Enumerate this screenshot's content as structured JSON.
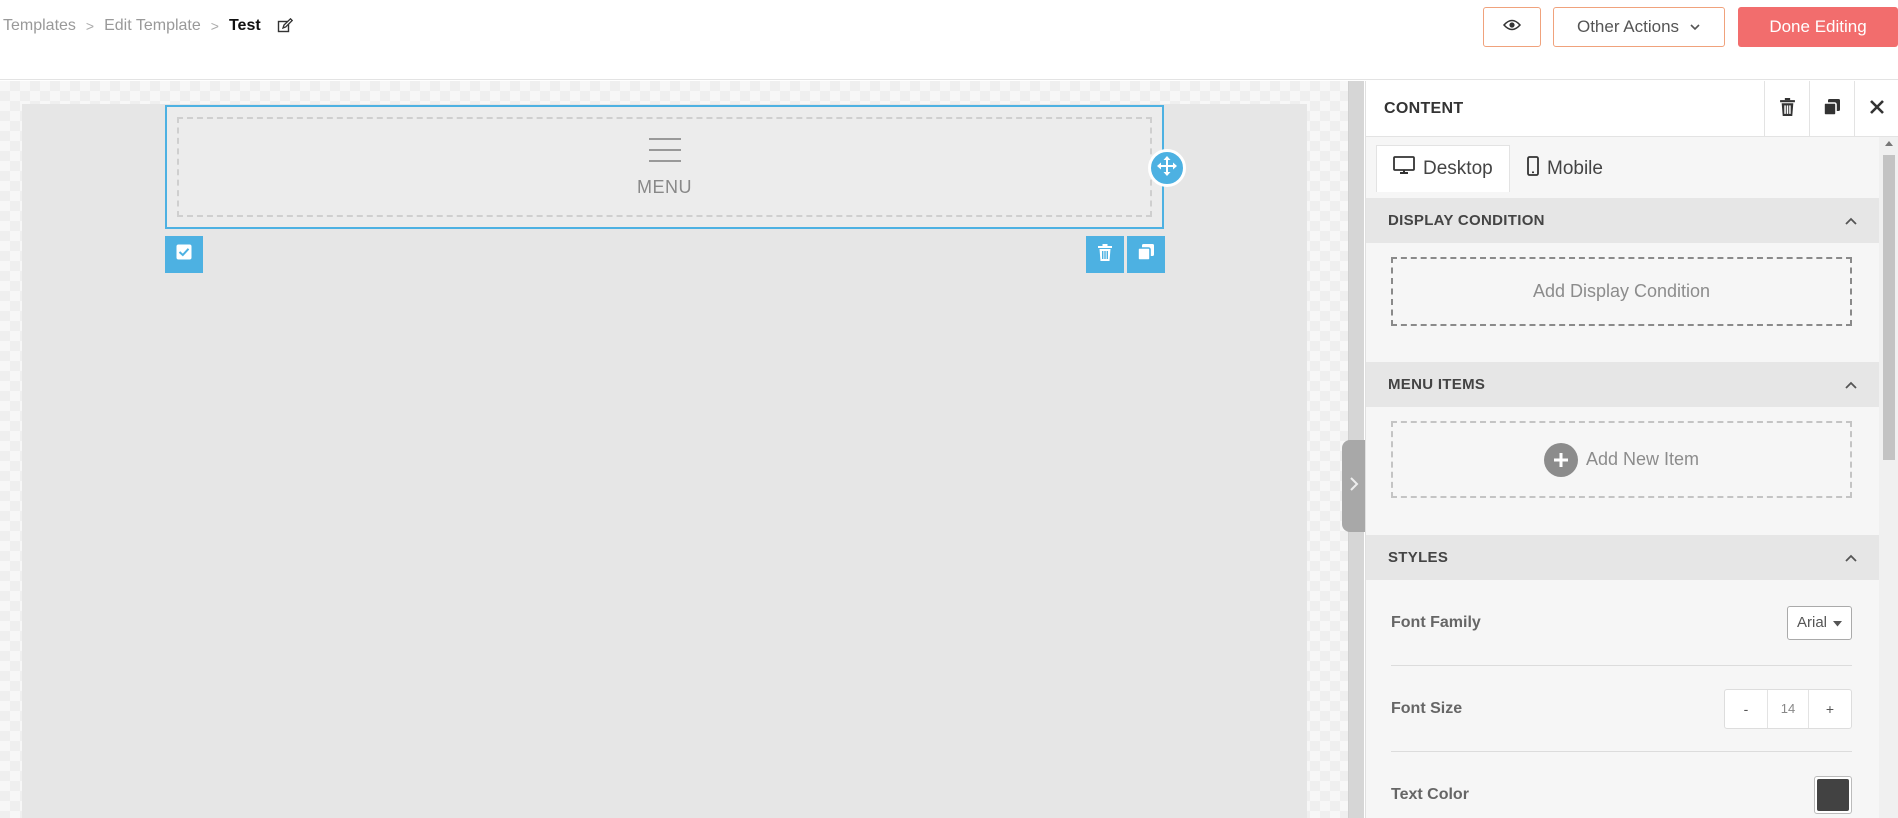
{
  "breadcrumb": {
    "items": [
      "Templates",
      "Edit Template"
    ],
    "separator": ">",
    "current": "Test"
  },
  "header": {
    "preview_icon": "eye-icon",
    "other_actions_label": "Other Actions",
    "done_label": "Done Editing"
  },
  "canvas": {
    "menu_label": "MENU"
  },
  "panel": {
    "title": "CONTENT",
    "tabs": [
      {
        "label": "Desktop",
        "icon": "desktop-icon",
        "active": true
      },
      {
        "label": "Mobile",
        "icon": "mobile-icon",
        "active": false
      }
    ],
    "sections": {
      "display_condition": {
        "title": "DISPLAY CONDITION",
        "button": "Add Display Condition"
      },
      "menu_items": {
        "title": "MENU ITEMS",
        "button": "Add New Item"
      },
      "styles": {
        "title": "STYLES",
        "font_family": {
          "label": "Font Family",
          "value": "Arial"
        },
        "font_size": {
          "label": "Font Size",
          "value": "14",
          "minus": "-",
          "plus": "+"
        },
        "text_color": {
          "label": "Text Color",
          "value": "#424242"
        }
      }
    }
  },
  "colors": {
    "accent": "#4db1e2",
    "done_button": "#f26d6d",
    "outline_button_border": "#f0a27c"
  }
}
